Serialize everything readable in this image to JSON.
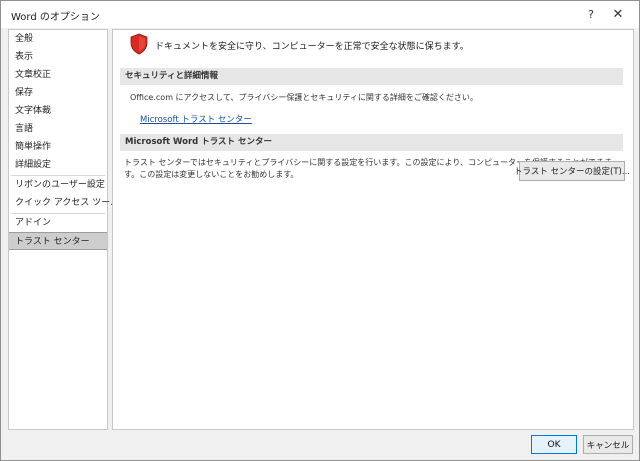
{
  "window": {
    "title": "Word のオプション",
    "help_label": "?",
    "close_label": "✕"
  },
  "sidebar": {
    "items": [
      {
        "label": "全般"
      },
      {
        "label": "表示"
      },
      {
        "label": "文章校正"
      },
      {
        "label": "保存"
      },
      {
        "label": "文字体裁"
      },
      {
        "label": "言語"
      },
      {
        "label": "簡単操作"
      },
      {
        "label": "詳細設定"
      },
      {
        "label": "リボンのユーザー設定"
      },
      {
        "label": "クイック アクセス ツール バー"
      },
      {
        "label": "アドイン"
      },
      {
        "label": "トラスト センター"
      }
    ],
    "selected": "トラスト センター"
  },
  "main": {
    "headline": "ドキュメントを安全に守り、コンピューターを正常で安全な状態に保ちます。",
    "headline_icon": "shield-icon",
    "shield_color": "#d42a22",
    "security_section": {
      "header": "セキュリティと詳細情報",
      "text": "Office.com にアクセスして、プライバシー保護とセキュリティに関する詳細をご確認ください。",
      "link": "Microsoft トラスト センター"
    },
    "trust_section": {
      "header": "Microsoft Word トラスト センター",
      "text_line1": "トラスト センターではセキュリティとプライバシーに関する設定を行います。この設定により、コンピューターを保護することができま",
      "text_line2": "す。この設定は変更しないことをお勧めします。",
      "button": "トラスト センターの設定(T)..."
    }
  },
  "footer": {
    "ok": "OK",
    "cancel": "キャンセル"
  },
  "colors": {
    "link": "#1e50a0",
    "accent": "#0078d7",
    "selected_bg": "#cdcdcd"
  }
}
